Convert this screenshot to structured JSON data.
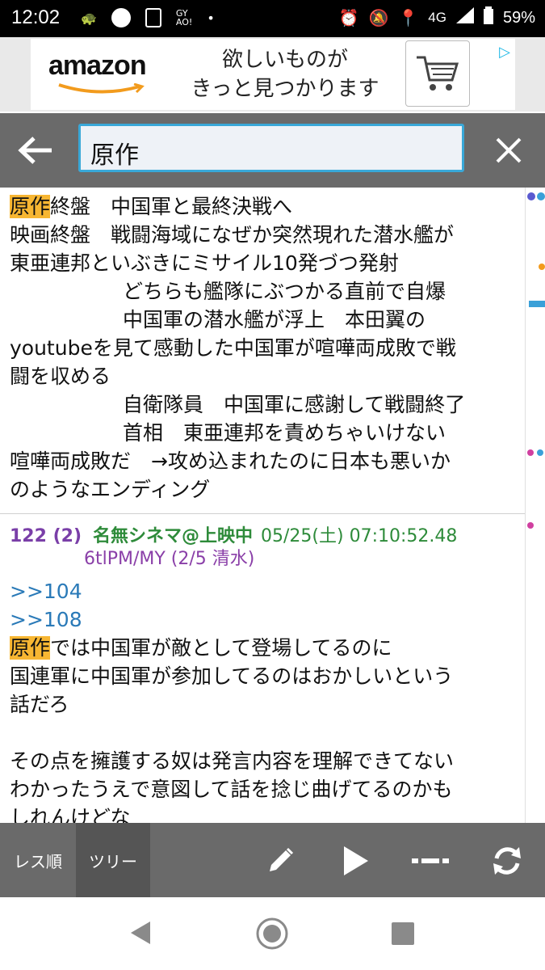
{
  "status_bar": {
    "time": "12:02",
    "network": "4G",
    "battery": "59%"
  },
  "ad": {
    "brand": "amazon",
    "text_line1": "欲しいものが",
    "text_line2": "きっと見つかります"
  },
  "toolbar": {
    "search_value": "原作"
  },
  "post1": {
    "lines": [
      {
        "hl": "原作",
        "text": "終盤　中国軍と最終決戦へ"
      },
      {
        "hl": "",
        "text": "映画終盤　戦闘海域になぜか突然現れた潜水艦が"
      },
      {
        "hl": "",
        "text": "東亜連邦といぶきにミサイル10発づつ発射"
      },
      {
        "hl": "",
        "text": "どちらも艦隊にぶつかる直前で自爆",
        "indent": true
      },
      {
        "hl": "",
        "text": "中国軍の潜水艦が浮上　本田翼の",
        "indent": true
      },
      {
        "hl": "",
        "text": "youtubeを見て感動した中国軍が喧嘩両成敗で戦"
      },
      {
        "hl": "",
        "text": "闘を収める"
      },
      {
        "hl": "",
        "text": "自衛隊員　中国軍に感謝して戦闘終了",
        "indent": true
      },
      {
        "hl": "",
        "text": "首相　東亜連邦を責めちゃいけない",
        "indent": true
      },
      {
        "hl": "",
        "text": "喧嘩両成敗だ　→攻め込まれたのに日本も悪いか"
      },
      {
        "hl": "",
        "text": "のようなエンディング"
      }
    ]
  },
  "post2": {
    "number": "122 (2)",
    "name": "名無シネマ@上映中",
    "date": "05/25(土) 07:10:52.48",
    "id": "6tlPM/MY (2/5 清水)",
    "anchor1": ">>104",
    "anchor2": ">>108",
    "hl": "原作",
    "line1_rest": "では中国軍が敵として登場してるのに",
    "line2": "国連軍に中国軍が参加してるのはおかしいという",
    "line3": "話だろ",
    "line4": "その点を擁護する奴は発言内容を理解できてない",
    "line5": "わかったうえで意図して話を捻じ曲げてるのかも",
    "line6": "しれんけどな"
  },
  "bottom_bar": {
    "tab_res": "レス順",
    "tab_tree": "ツリー"
  },
  "colors": {
    "highlight": "#f7b632",
    "toolbar": "#6a6a6a",
    "search_border": "#39a8d8"
  }
}
